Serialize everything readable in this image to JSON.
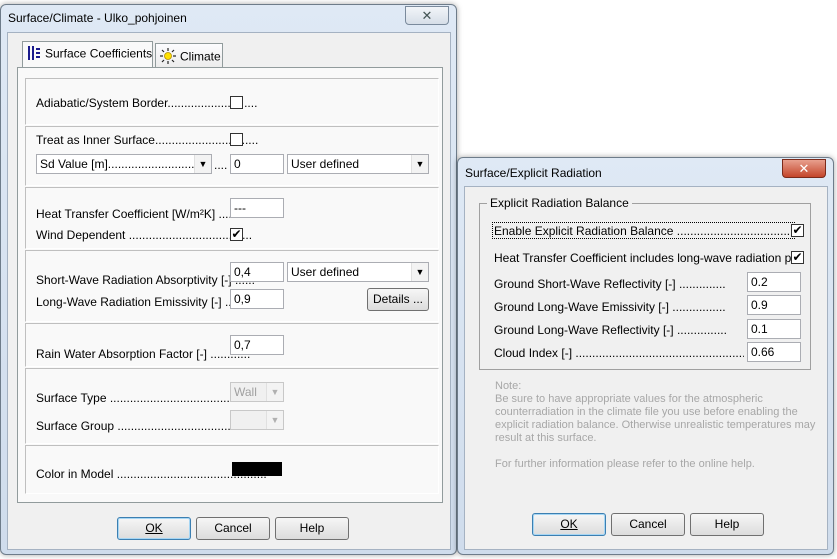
{
  "window1": {
    "title": "Surface/Climate - Ulko_pohjoinen",
    "close": "✕",
    "tabs": [
      {
        "label": "Surface Coefficients",
        "icon": "surface-coefficients-icon"
      },
      {
        "label": "Climate",
        "icon": "sun-icon"
      }
    ],
    "adiabatic_label": "Adiabatic/System Border...........................",
    "inner_surface_label": "Treat as Inner Surface...............................",
    "sd_select": "Sd Value [m]...................................",
    "sd_value": "0",
    "sd_mode": "User defined",
    "htc_label": "Heat Transfer Coefficient [W/m²K] .........",
    "htc_value": "---",
    "wind_label": "Wind Dependent .....................................",
    "wind_checked": "✔",
    "swa_label": "Short-Wave Radiation Absorptivity [-] ......",
    "swa_value": "0,4",
    "swa_mode": "User defined",
    "lwe_label": "Long-Wave Radiation Emissivity [-] .........",
    "lwe_value": "0,9",
    "details_label": "Details ...",
    "rain_label": "Rain Water Absorption Factor [-] ............",
    "rain_value": "0,7",
    "surface_type_label": "Surface Type ..............................................",
    "surface_type_value": "Wall",
    "surface_group_label": "Surface Group ............................................",
    "color_label": "Color in Model .............................................",
    "color_swatch": "#000000",
    "ok": "OK",
    "cancel": "Cancel",
    "help": "Help"
  },
  "window2": {
    "title": "Surface/Explicit Radiation",
    "close": "✕",
    "group_title": "Explicit Radiation Balance",
    "enable_label": "Enable Explicit Radiation Balance ...............................................",
    "enable_checked": "✔",
    "htc_includes_label": "Heat Transfer Coefficient includes long-wave radiation parts ....",
    "htc_includes_checked": "✔",
    "gsw_label": "Ground Short-Wave Reflectivity [-] ......................",
    "gsw_value": "0.2",
    "glw_label": "Ground Long-Wave Emissivity [-] ........................",
    "glw_value": "0.9",
    "glr_label": "Ground Long-Wave Reflectivity [-] .....................",
    "glr_value": "0.1",
    "cloud_label": "Cloud Index [-] ...................................................",
    "cloud_value": "0.66",
    "note_title": "Note:",
    "note_lines": [
      "Be sure to have appropriate values for the atmospheric",
      "counterradiation in the climate file you use before enabling the",
      "explicit radiation balance. Otherwise unrealistic temperatures may",
      "result at this surface."
    ],
    "note_further": "For further information please refer to the online help.",
    "ok": "OK",
    "cancel": "Cancel",
    "help": "Help"
  }
}
